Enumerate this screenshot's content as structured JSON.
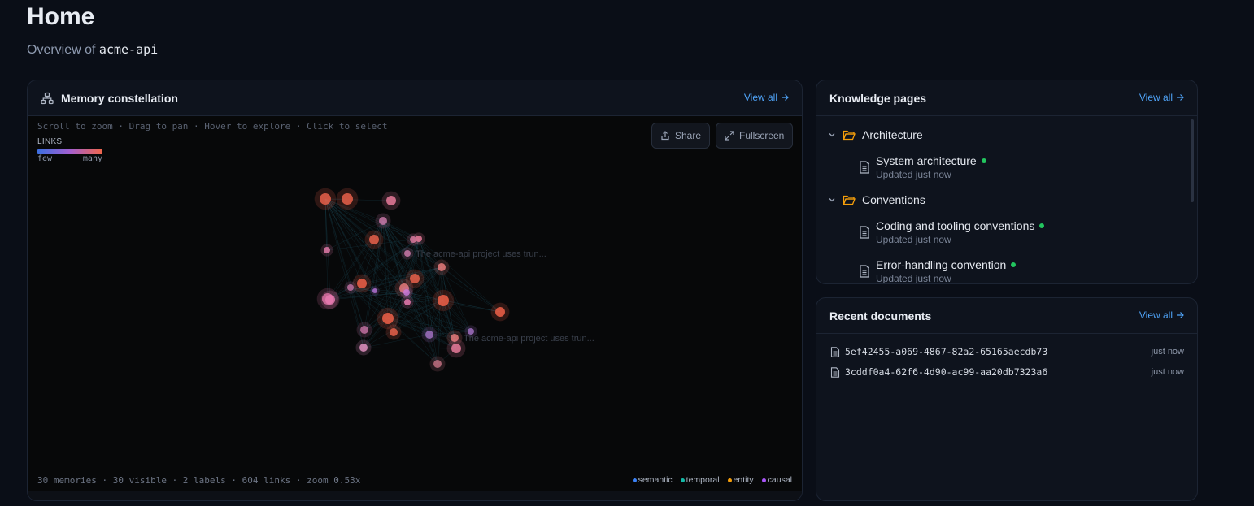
{
  "page": {
    "title": "Home",
    "subtitle_prefix": "Overview of",
    "project": "acme-api"
  },
  "constellation": {
    "title": "Memory constellation",
    "view_all": "View all",
    "hint": "Scroll to zoom · Drag to pan · Hover to explore · Click to select",
    "links_label": "LINKS",
    "links_few": "few",
    "links_many": "many",
    "share_label": "Share",
    "fullscreen_label": "Fullscreen",
    "stats": "30 memories · 30 visible · 2 labels · 604 links · zoom 0.53x",
    "node_labels": [
      "The acme-api project uses trun...",
      "The acme-api project uses trun..."
    ],
    "link_types": [
      {
        "name": "semantic",
        "color": "#3b82f6"
      },
      {
        "name": "temporal",
        "color": "#14b8a6"
      },
      {
        "name": "entity",
        "color": "#f59e0b"
      },
      {
        "name": "causal",
        "color": "#a855f7"
      }
    ]
  },
  "knowledge": {
    "title": "Knowledge pages",
    "view_all": "View all",
    "folders": [
      {
        "name": "Architecture",
        "pages": [
          {
            "title": "System architecture",
            "updated": "Updated just now"
          }
        ]
      },
      {
        "name": "Conventions",
        "pages": [
          {
            "title": "Coding and tooling conventions",
            "updated": "Updated just now"
          },
          {
            "title": "Error-handling convention",
            "updated": "Updated just now"
          }
        ]
      }
    ]
  },
  "recent": {
    "title": "Recent documents",
    "view_all": "View all",
    "items": [
      {
        "name": "5ef42455-a069-4867-82a2-65165aecdb73",
        "time": "just now"
      },
      {
        "name": "3cddf0a4-62f6-4d90-ac99-aa20db7323a6",
        "time": "just now"
      }
    ]
  }
}
